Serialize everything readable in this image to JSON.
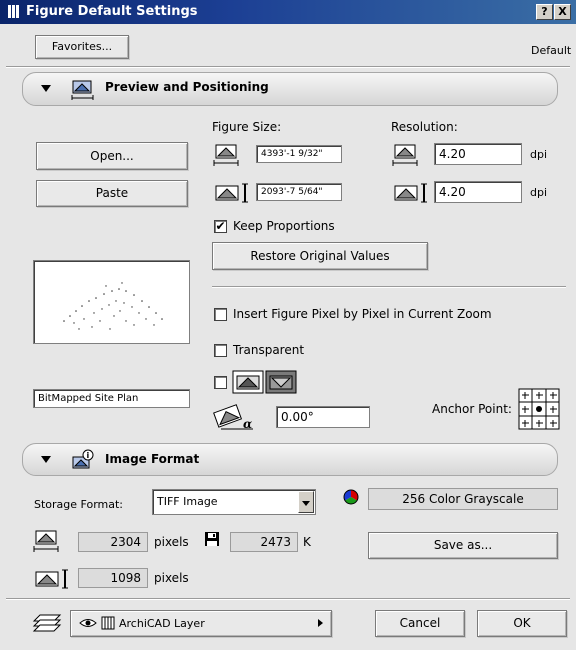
{
  "window": {
    "title": "Figure Default Settings",
    "help_label": "?",
    "close_label": "X"
  },
  "top": {
    "favorites_label": "Favorites...",
    "default_label": "Default"
  },
  "preview": {
    "header": "Preview and Positioning",
    "open_label": "Open...",
    "paste_label": "Paste",
    "figure_size_label": "Figure Size:",
    "resolution_label": "Resolution:",
    "width_value": "4393'-1 9/32\"",
    "height_value": "2093'-7 5/64\"",
    "res_h_value": "4.20",
    "res_v_value": "4.20",
    "dpi_label": "dpi",
    "keep_proportions_label": "Keep Proportions",
    "keep_proportions_checked": "✔",
    "restore_label": "Restore Original Values",
    "insert_pixel_label": "Insert Figure Pixel by Pixel in Current Zoom",
    "transparent_label": "Transparent",
    "name_value": "BitMapped Site Plan",
    "angle_value": "0.00°",
    "anchor_label": "Anchor Point:"
  },
  "image_format": {
    "header": "Image Format",
    "storage_label": "Storage Format:",
    "storage_value": "TIFF Image",
    "color_value": "256 Color Grayscale",
    "width_px": "2304",
    "height_px": "1098",
    "pixels_label": "pixels",
    "size_k": "2473",
    "k_label": "K",
    "save_as_label": "Save as..."
  },
  "footer": {
    "layer_value": "ArchiCAD Layer",
    "cancel_label": "Cancel",
    "ok_label": "OK"
  }
}
